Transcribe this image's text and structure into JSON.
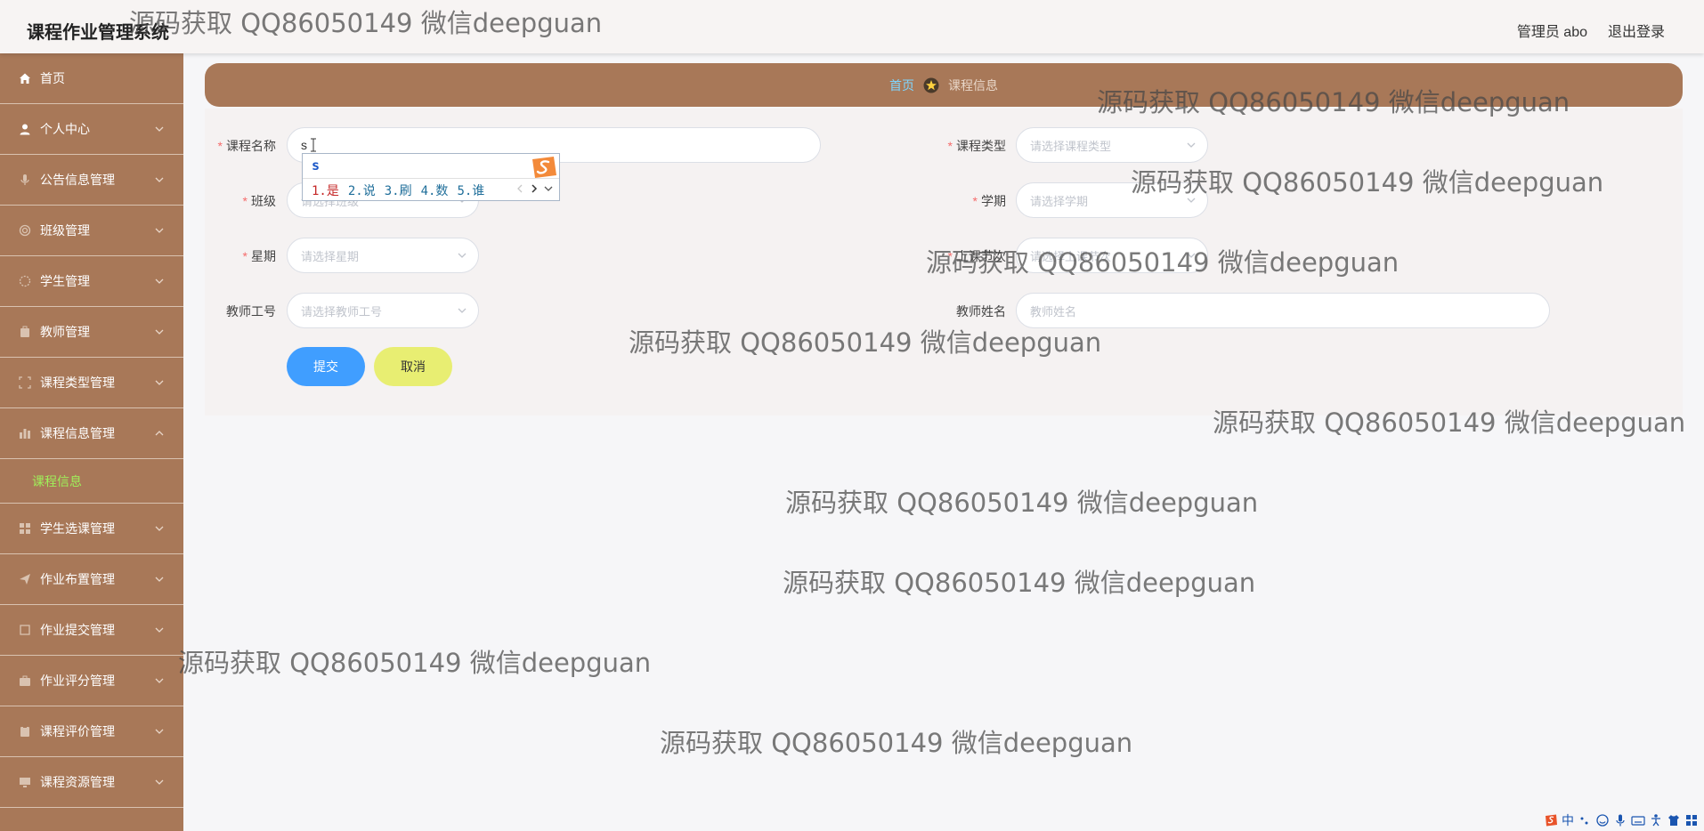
{
  "header": {
    "title": "课程作业管理系统",
    "user": "管理员 abo",
    "logout": "退出登录"
  },
  "sidebar": {
    "items": [
      {
        "label": "首页",
        "icon": "home-icon"
      },
      {
        "label": "个人中心",
        "icon": "user-icon"
      },
      {
        "label": "公告信息管理",
        "icon": "microphone-icon"
      },
      {
        "label": "班级管理",
        "icon": "target-icon"
      },
      {
        "label": "学生管理",
        "icon": "circle-dashed-icon"
      },
      {
        "label": "教师管理",
        "icon": "briefcase-icon"
      },
      {
        "label": "课程类型管理",
        "icon": "frame-icon"
      },
      {
        "label": "课程信息管理",
        "icon": "chart-icon",
        "expanded": true,
        "children": [
          "课程信息"
        ]
      },
      {
        "label": "学生选课管理",
        "icon": "grid-icon"
      },
      {
        "label": "作业布置管理",
        "icon": "send-icon"
      },
      {
        "label": "作业提交管理",
        "icon": "crop-icon"
      },
      {
        "label": "作业评分管理",
        "icon": "case-icon"
      },
      {
        "label": "课程评价管理",
        "icon": "clipboard-icon"
      },
      {
        "label": "课程资源管理",
        "icon": "monitor-icon"
      }
    ]
  },
  "breadcrumb": {
    "home": "首页",
    "current": "课程信息"
  },
  "form": {
    "course_name": {
      "label": "课程名称",
      "value": "s",
      "required": true
    },
    "course_type": {
      "label": "课程类型",
      "placeholder": "请选择课程类型",
      "required": true
    },
    "class": {
      "label": "班级",
      "placeholder": "请选择班级",
      "required": true
    },
    "semester": {
      "label": "学期",
      "placeholder": "请选择学期",
      "required": true
    },
    "weekday": {
      "label": "星期",
      "placeholder": "请选择星期",
      "required": true
    },
    "period": {
      "label": "上课节次",
      "placeholder": "请选择上课节次",
      "required": true
    },
    "teacher_id": {
      "label": "教师工号",
      "placeholder": "请选择教师工号",
      "required": false
    },
    "teacher_name": {
      "label": "教师姓名",
      "placeholder": "教师姓名",
      "required": false
    },
    "submit": "提交",
    "cancel": "取消"
  },
  "ime": {
    "composition": "s",
    "candidates": [
      "1.是",
      "2.说",
      "3.刷",
      "4.数",
      "5.谁"
    ]
  },
  "watermark": "源码获取 QQ86050149 微信deepguan",
  "tray": {
    "lang": "中"
  },
  "colors": {
    "sidebar": "#a87858",
    "breadcrumb_bg": "#a87858",
    "submit": "#409eff",
    "cancel": "#e8ee72",
    "active_submenu": "#9ff05a",
    "breadcrumb_home": "#7ed6ff"
  }
}
